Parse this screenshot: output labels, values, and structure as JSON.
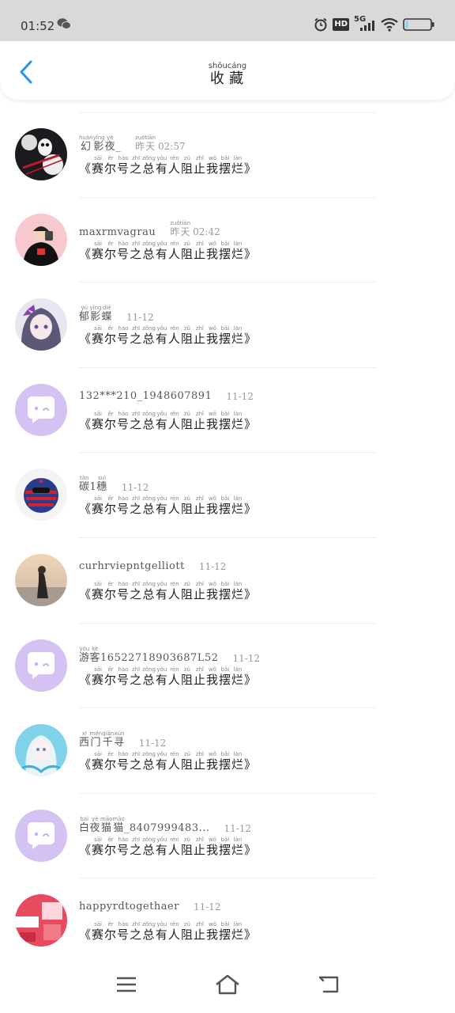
{
  "status_bar": {
    "time": "01:52",
    "icons": [
      "wechat-icon",
      "alarm-icon",
      "hd-icon",
      "signal-5g-icon",
      "wifi-icon",
      "battery-icon"
    ],
    "hd_label": "HD",
    "net_label": "5G"
  },
  "header": {
    "title": "收藏",
    "title_pinyin": "shōucáng",
    "back_icon": "chevron-left-icon",
    "accent_color": "#2196f3"
  },
  "book_title_chars": [
    {
      "c": "《",
      "p": ""
    },
    {
      "c": "赛",
      "p": "sāi"
    },
    {
      "c": "尔",
      "p": "ěr"
    },
    {
      "c": "号",
      "p": "hào"
    },
    {
      "c": "之",
      "p": "zhī"
    },
    {
      "c": "总",
      "p": "zǒng"
    },
    {
      "c": "有",
      "p": "yǒu"
    },
    {
      "c": "人",
      "p": "rén"
    },
    {
      "c": "阻",
      "p": "zǔ"
    },
    {
      "c": "止",
      "p": "zhǐ"
    },
    {
      "c": "我",
      "p": "wǒ"
    },
    {
      "c": "摆",
      "p": "bǎi"
    },
    {
      "c": "烂",
      "p": "làn"
    },
    {
      "c": "》",
      "p": ""
    }
  ],
  "items": [
    {
      "avatar": "avatar-penguin",
      "name_parts": [
        {
          "c": "幻",
          "p": "huàn"
        },
        {
          "c": "影",
          "p": "yǐng"
        },
        {
          "c": "夜",
          "p": "yè"
        },
        {
          "c": "_",
          "p": ""
        }
      ],
      "time_parts": [
        {
          "c": "昨",
          "p": "zuó"
        },
        {
          "c": "天",
          "p": "tiān"
        },
        {
          "c": " 02:57",
          "p": ""
        }
      ]
    },
    {
      "avatar": "avatar-hoodie",
      "name_parts": [
        {
          "c": "maxrmvagrau",
          "p": ""
        }
      ],
      "time_parts": [
        {
          "c": "昨",
          "p": "zuó"
        },
        {
          "c": "天",
          "p": "tiān"
        },
        {
          "c": " 02:42",
          "p": ""
        }
      ]
    },
    {
      "avatar": "avatar-anime-girl-purple",
      "name_parts": [
        {
          "c": "郁",
          "p": "yù"
        },
        {
          "c": "影",
          "p": "yǐng"
        },
        {
          "c": "蝶",
          "p": "dié"
        }
      ],
      "time_parts": [
        {
          "c": "11-12",
          "p": ""
        }
      ]
    },
    {
      "avatar": "avatar-default",
      "name_parts": [
        {
          "c": "132***210_1948607891",
          "p": ""
        }
      ],
      "time_parts": [
        {
          "c": "11-12",
          "p": ""
        }
      ]
    },
    {
      "avatar": "avatar-flag-character",
      "name_parts": [
        {
          "c": "碳",
          "p": "tàn"
        },
        {
          "c": "1",
          "p": ""
        },
        {
          "c": "穗",
          "p": "suì"
        }
      ],
      "time_parts": [
        {
          "c": "11-12",
          "p": ""
        }
      ]
    },
    {
      "avatar": "avatar-beach-girl",
      "name_parts": [
        {
          "c": "curhrviepntgelliott",
          "p": ""
        }
      ],
      "time_parts": [
        {
          "c": "11-12",
          "p": ""
        }
      ]
    },
    {
      "avatar": "avatar-default",
      "name_parts": [
        {
          "c": "游",
          "p": "yóu"
        },
        {
          "c": "客",
          "p": "kè"
        },
        {
          "c": "16522718903687L52",
          "p": ""
        }
      ],
      "time_parts": [
        {
          "c": "11-12",
          "p": ""
        }
      ]
    },
    {
      "avatar": "avatar-anime-girl-blue",
      "name_parts": [
        {
          "c": "西",
          "p": "xī"
        },
        {
          "c": "门",
          "p": "mén"
        },
        {
          "c": "千",
          "p": "qiān"
        },
        {
          "c": "寻",
          "p": "xún"
        }
      ],
      "time_parts": [
        {
          "c": "11-12",
          "p": ""
        }
      ]
    },
    {
      "avatar": "avatar-default",
      "name_parts": [
        {
          "c": "白",
          "p": "bái"
        },
        {
          "c": "夜",
          "p": "yè"
        },
        {
          "c": "猫",
          "p": "māo"
        },
        {
          "c": "猫",
          "p": "māo"
        },
        {
          "c": "_8407999483...",
          "p": ""
        }
      ],
      "time_parts": [
        {
          "c": "11-12",
          "p": ""
        }
      ]
    },
    {
      "avatar": "avatar-red-photo",
      "name_parts": [
        {
          "c": "happyrdtogethaer",
          "p": ""
        }
      ],
      "time_parts": [
        {
          "c": "11-12",
          "p": ""
        }
      ]
    }
  ],
  "bottom_nav": {
    "icons": [
      "menu-icon",
      "home-icon",
      "back-nav-icon"
    ]
  }
}
